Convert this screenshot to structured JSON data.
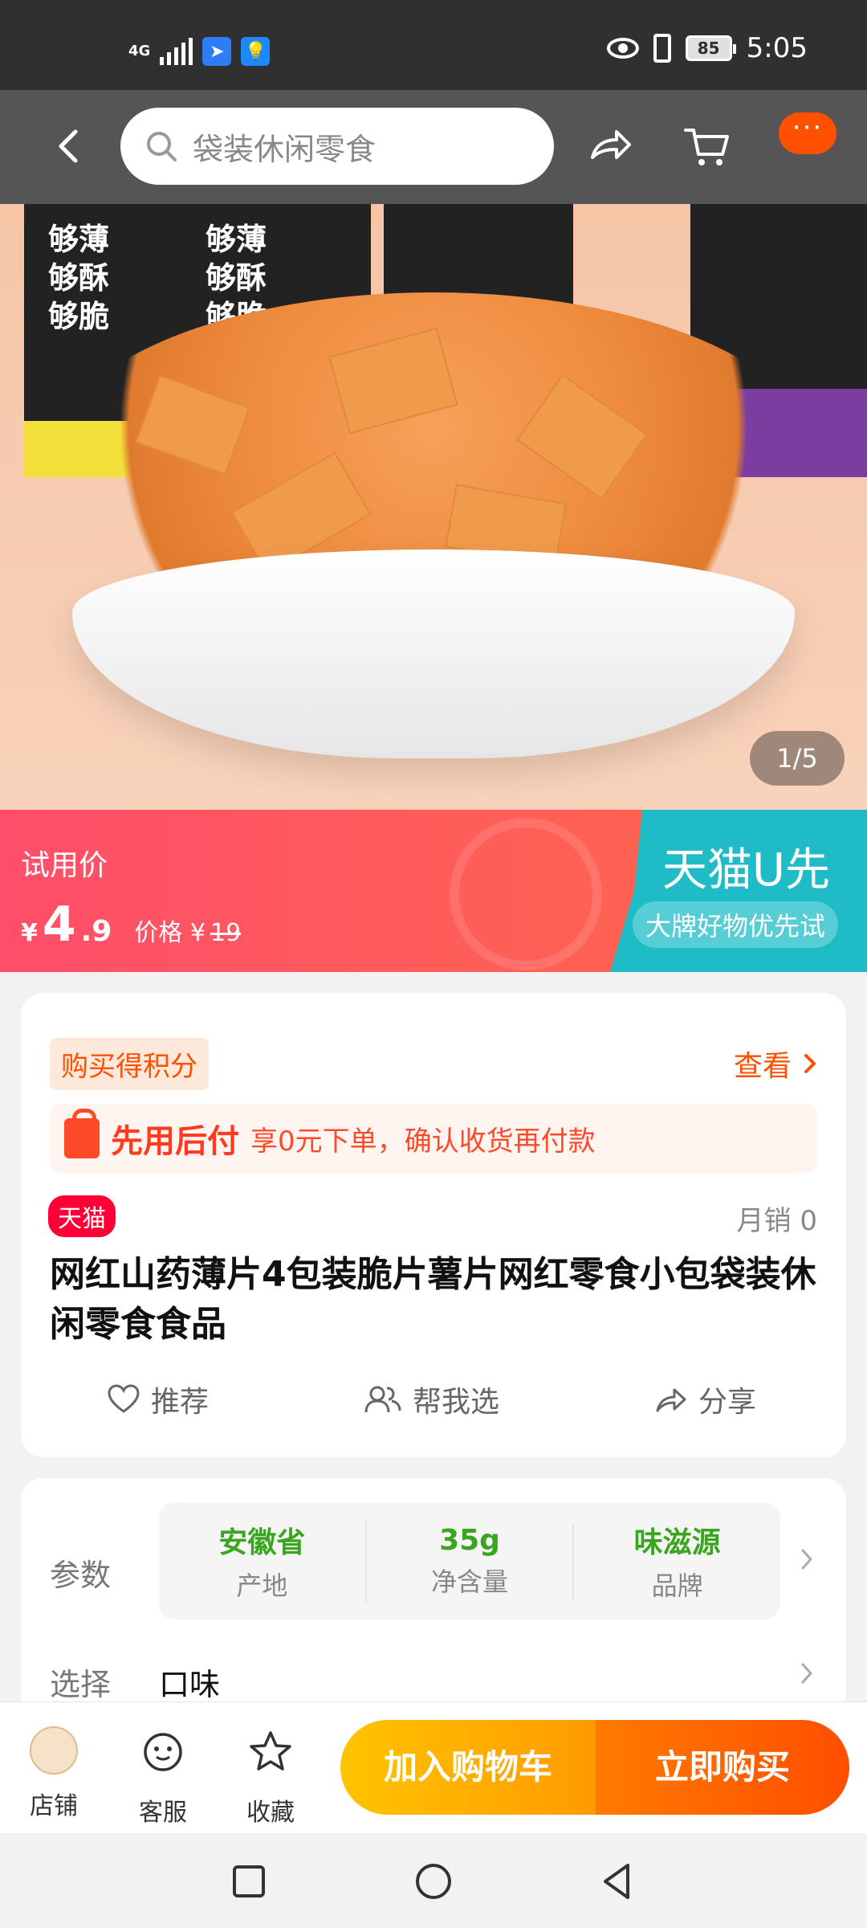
{
  "status_bar": {
    "network": "4G",
    "battery": "85",
    "time": "5:05"
  },
  "nav": {
    "search_placeholder": "袋装休闲零食",
    "more_label": "···"
  },
  "hero": {
    "pager": "1/5",
    "can_text": "够薄\n够酥\n够脆"
  },
  "promo": {
    "trial_label": "试用价",
    "currency": "¥",
    "price_int": "4",
    "price_dec": ".9",
    "original_label": "价格 ¥",
    "original_price": "19",
    "u_title": "天猫U先",
    "u_sub": "大牌好物优先试"
  },
  "product": {
    "points_tag": "购买得积分",
    "view_link": "查看",
    "paylater_title": "先用后付",
    "paylater_desc": "享0元下单，确认收货再付款",
    "tmall_tag": "天猫",
    "monthly_sales": "月销 0",
    "title": "网红山药薄片4包装脆片薯片网红零食小包袋装休闲零食食品",
    "actions": [
      {
        "label": "推荐"
      },
      {
        "label": "帮我选"
      },
      {
        "label": "分享"
      }
    ]
  },
  "params": {
    "label": "参数",
    "items": [
      {
        "value": "安徽省",
        "key": "产地"
      },
      {
        "value": "35g",
        "key": "净含量"
      },
      {
        "value": "味滋源",
        "key": "品牌"
      }
    ],
    "select_label": "选择",
    "select_value": "口味"
  },
  "bottom_bar": {
    "store": "店铺",
    "service": "客服",
    "favorite": "收藏",
    "add_to_cart": "加入购物车",
    "buy_now": "立即购买"
  },
  "colors": {
    "accent": "#ff5000",
    "promo_red": "#ff4e6a",
    "promo_teal": "#1fbcc7",
    "param_green": "#3aa620"
  }
}
